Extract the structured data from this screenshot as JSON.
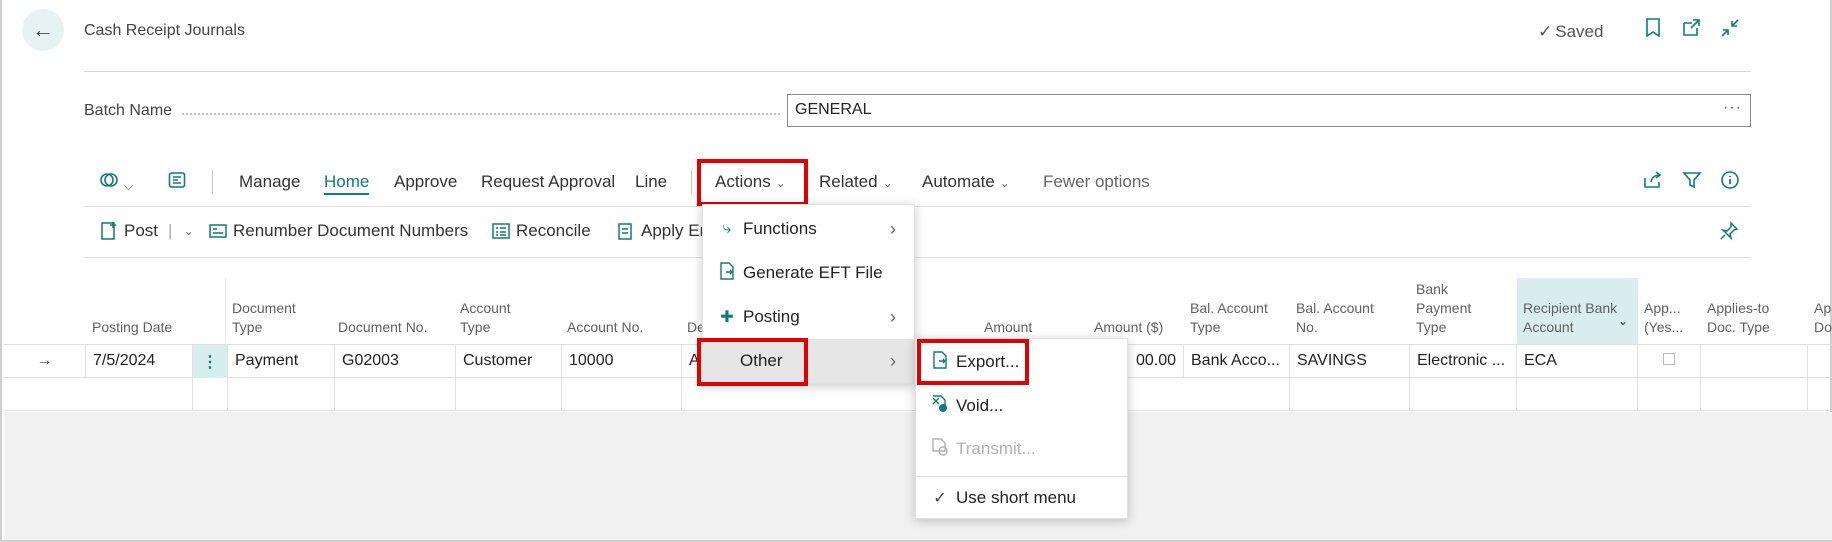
{
  "header": {
    "back_icon": "arrow-left-icon",
    "title": "Cash Receipt Journals",
    "saved_label": "Saved"
  },
  "batch": {
    "label": "Batch Name",
    "value": "GENERAL",
    "more": "···"
  },
  "toolbar": {
    "tabs": [
      "Manage",
      "Home",
      "Approve",
      "Request Approval",
      "Line",
      "Actions",
      "Related",
      "Automate",
      "Fewer options"
    ],
    "active_tab": "Home"
  },
  "subbar": {
    "post": "Post",
    "renumber": "Renumber Document Numbers",
    "reconcile": "Reconcile",
    "apply": "Apply En"
  },
  "grid": {
    "headers": {
      "posting_date": "Posting Date",
      "document_type_1": "Document",
      "document_type_2": "Type",
      "document_no": "Document No.",
      "account_type_1": "Account",
      "account_type_2": "Type",
      "account_no": "Account No.",
      "description": "De",
      "amount": "Amount",
      "amount_usd": "Amount ($)",
      "bal_account_type_1": "Bal. Account",
      "bal_account_type_2": "Type",
      "bal_account_no_1": "Bal. Account",
      "bal_account_no_2": "No.",
      "bank_payment_type_1": "Bank",
      "bank_payment_type_2": "Payment",
      "bank_payment_type_3": "Type",
      "recipient_bank_1": "Recipient Bank",
      "recipient_bank_2": "Account",
      "app_yes_1": "App...",
      "app_yes_2": "(Yes...",
      "applies_to_1": "Applies-to",
      "applies_to_2": "Doc. Type",
      "ap_doc_1": "Ap",
      "ap_doc_2": "Do"
    },
    "row1": {
      "posting_date": "7/5/2024",
      "document_type": "Payment",
      "document_no": "G02003",
      "account_type": "Customer",
      "account_no": "10000",
      "description": "A",
      "amount_usd": "00.00",
      "bal_account_type": "Bank Acco...",
      "bal_account_no": "SAVINGS",
      "bank_payment_type": "Electronic ...",
      "recipient_bank": "ECA"
    }
  },
  "actions_menu": {
    "functions": "Functions",
    "generate_eft": "Generate EFT File",
    "posting": "Posting",
    "other": "Other"
  },
  "other_menu": {
    "export": "Export...",
    "void": "Void...",
    "transmit": "Transmit...",
    "use_short_menu": "Use short menu"
  },
  "colors": {
    "accent": "#0f7b7b",
    "highlight_box": "#e00000"
  }
}
